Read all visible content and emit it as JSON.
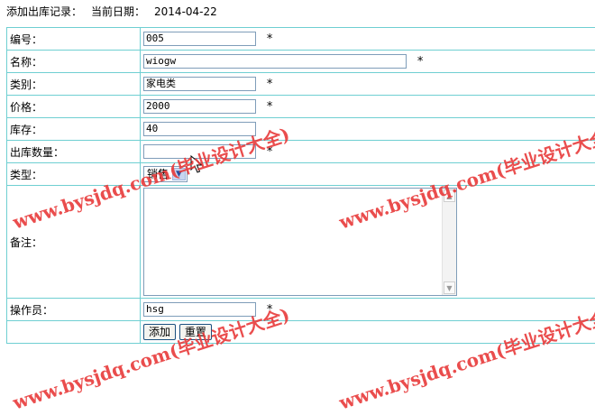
{
  "header": {
    "title": "添加出库记录：",
    "date_label": "当前日期：",
    "date_value": "2014-04-22"
  },
  "form": {
    "id": {
      "label": "编号：",
      "value": "005",
      "required": "*"
    },
    "name": {
      "label": "名称：",
      "value": "wiogw",
      "required": "*"
    },
    "category": {
      "label": "类别：",
      "value": "家电类",
      "required": "*"
    },
    "price": {
      "label": "价格：",
      "value": "2000",
      "required": "*"
    },
    "stock": {
      "label": "库存：",
      "value": "40"
    },
    "out_qty": {
      "label": "出库数量：",
      "value": "",
      "required": "*"
    },
    "type": {
      "label": "类型：",
      "selected": "销售"
    },
    "remark": {
      "label": "备注：",
      "value": ""
    },
    "operator": {
      "label": "操作员：",
      "value": "hsg",
      "required": "*"
    },
    "buttons": {
      "add": "添加",
      "reset": "重置"
    }
  },
  "watermark": {
    "text": "www.bysjdq.com(毕业设计大全)",
    "color": "#e83a3a"
  },
  "icons": [
    "dropdown-arrow-icon",
    "scroll-up-icon",
    "scroll-down-icon",
    "mouse-cursor-icon"
  ]
}
